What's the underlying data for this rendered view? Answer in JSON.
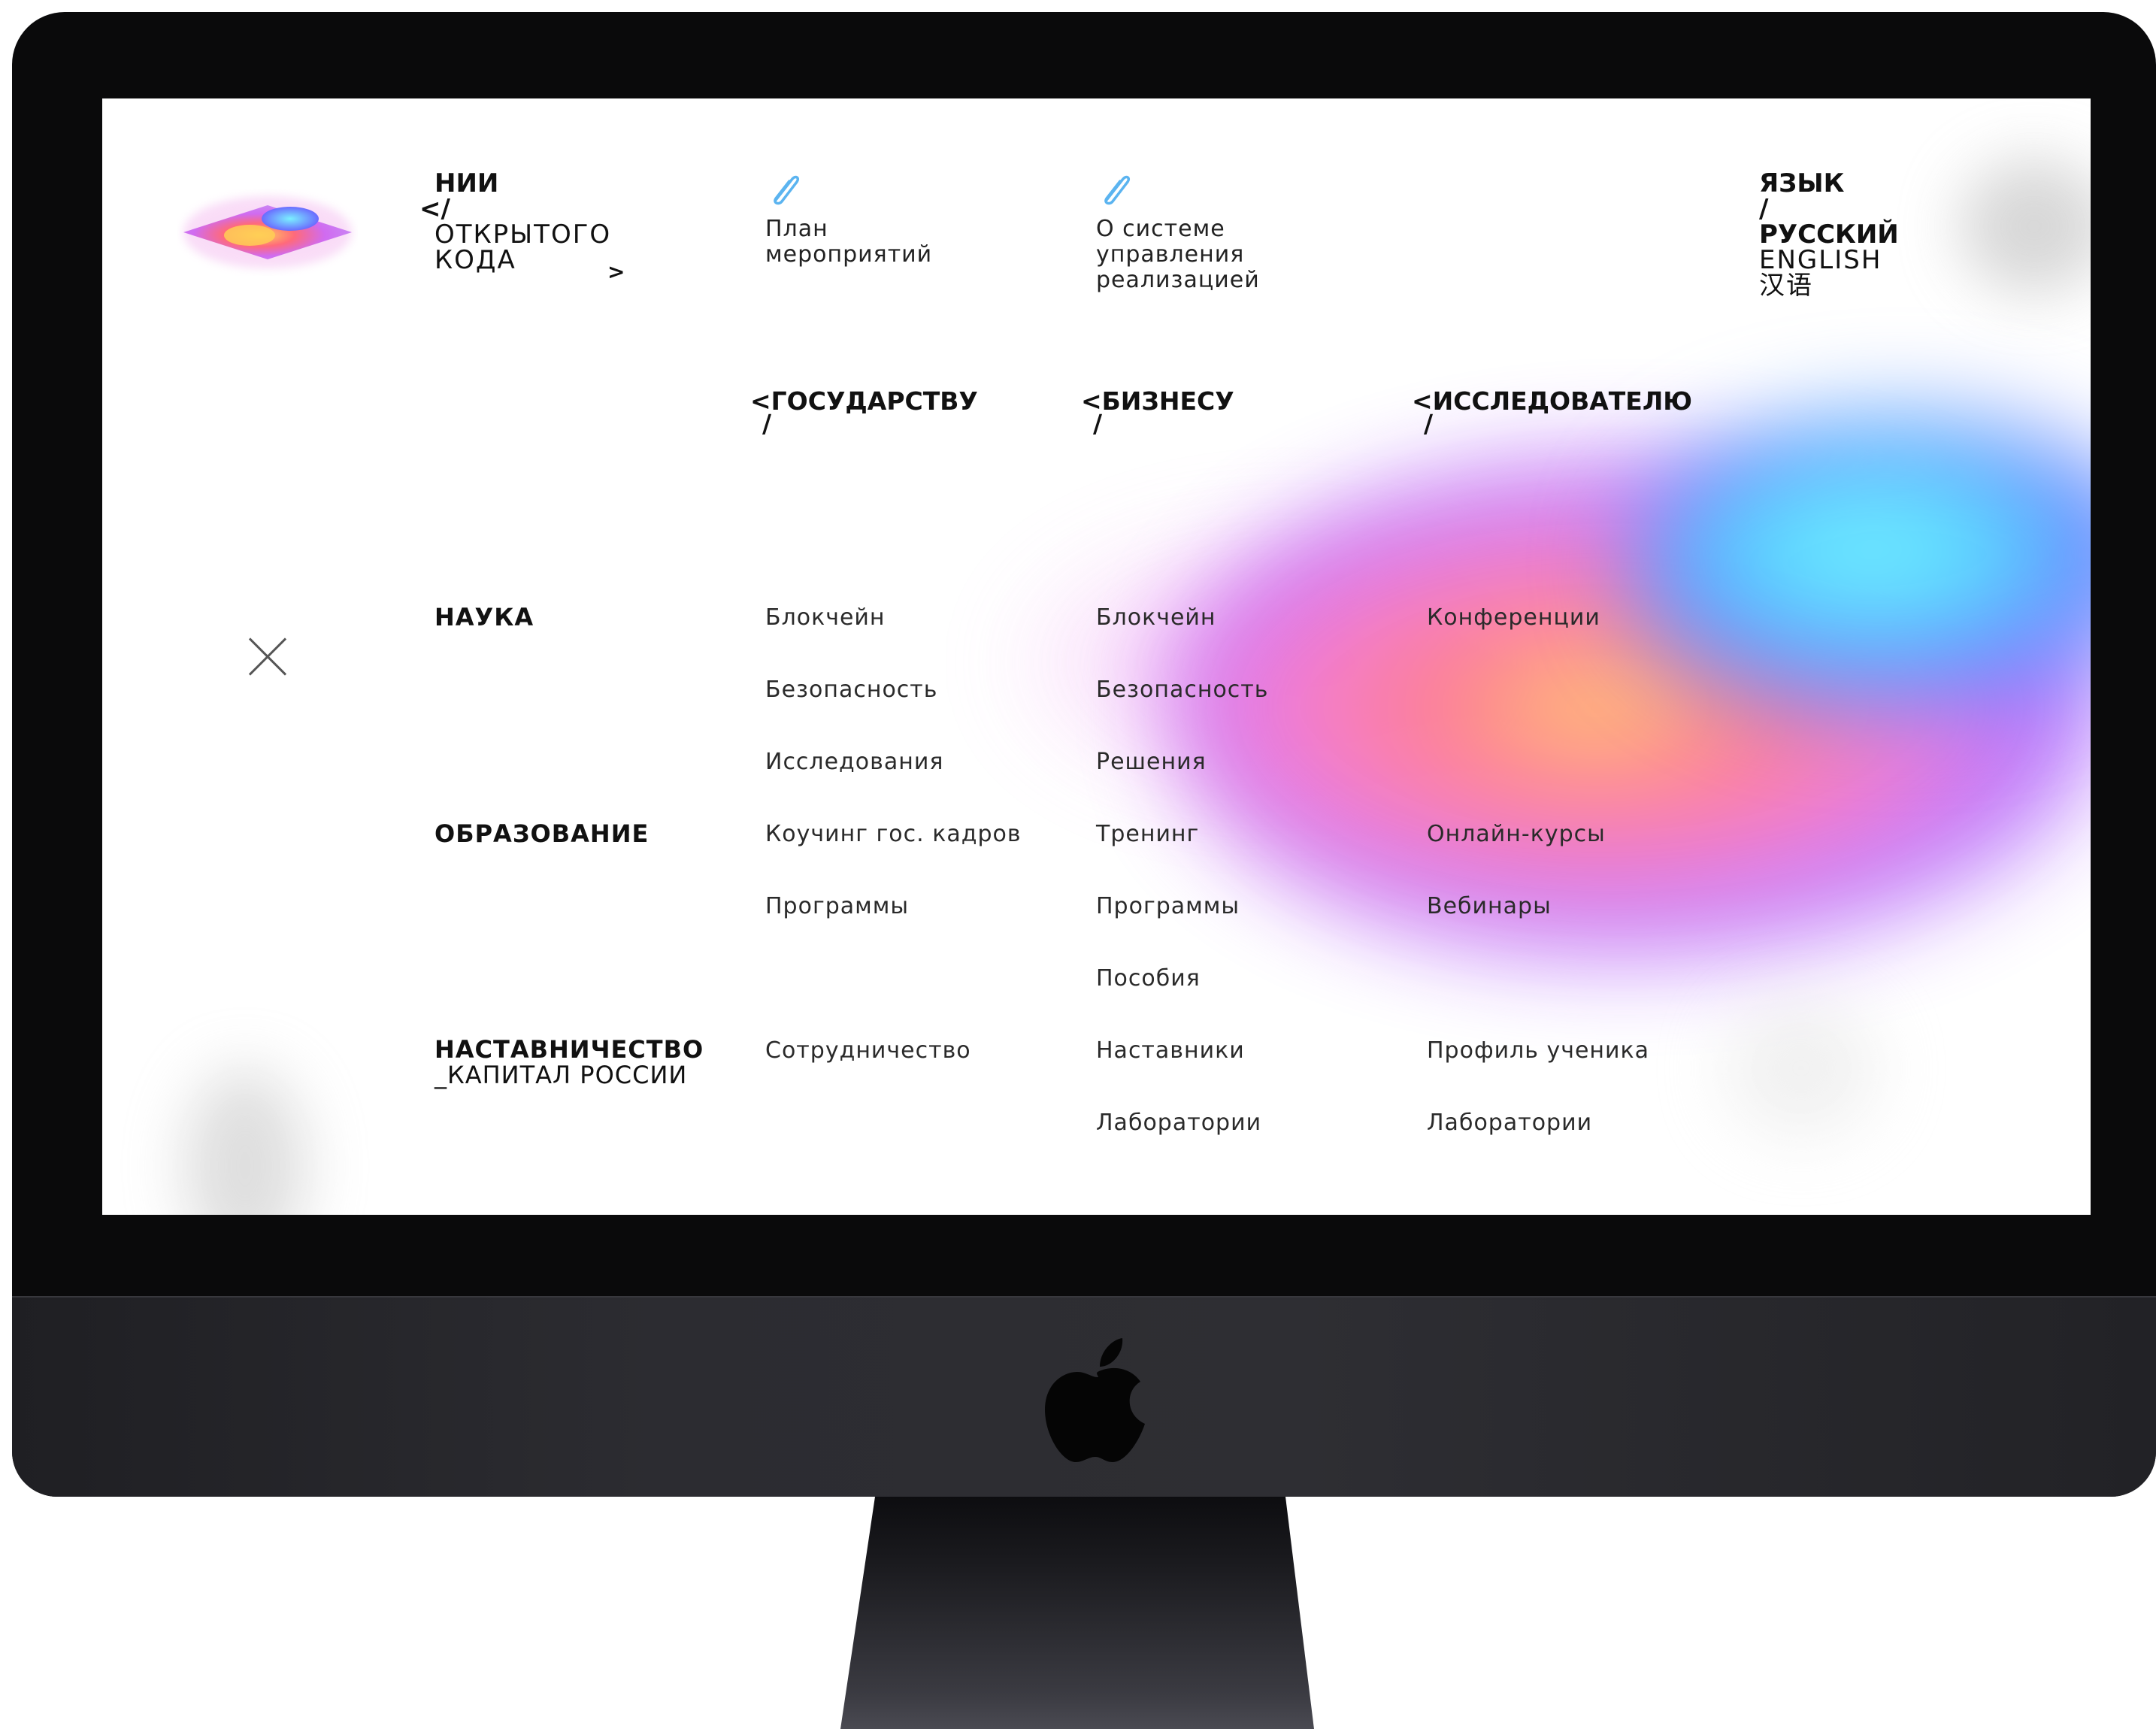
{
  "brand": {
    "line1": "НИИ",
    "line2": "</",
    "line3": "ОТКРЫТОГО",
    "line4": "КОДА",
    "line5": ">"
  },
  "nav": [
    {
      "icon": "paperclip-icon",
      "label": "План\nмероприятий"
    },
    {
      "icon": "paperclip-icon",
      "label": "О системе\nуправления\nреализацией"
    }
  ],
  "language": {
    "title": "ЯЗЫК",
    "slash": "/",
    "current": "РУССКИЙ",
    "options": [
      "ENGLISH",
      "汉语"
    ]
  },
  "audiences": [
    {
      "label": "<ГОСУДАРСТВУ",
      "slash": "/"
    },
    {
      "label": "<БИЗНЕСУ",
      "slash": "/"
    },
    {
      "label": "<ИССЛЕДОВАТЕЛЮ",
      "slash": "/"
    }
  ],
  "categories": [
    {
      "label": "НАУКА"
    },
    {
      "label": "ОБРАЗОВАНИЕ"
    },
    {
      "label": "НАСТАВНИЧЕСТВО",
      "sub": "_КАПИТАЛ РОССИИ"
    }
  ],
  "menu": {
    "gov": [
      "Блокчейн",
      "Безопасность",
      "Исследования",
      "Коучинг гос. кадров",
      "Программы",
      "Сотрудничество"
    ],
    "business": [
      "Блокчейн",
      "Безопасность",
      "Решения",
      "Тренинг",
      "Программы",
      "Пособия",
      "Наставники",
      "Лаборатории"
    ],
    "research": [
      "Конференции",
      "Онлайн-курсы",
      "Вебинары",
      "Профиль ученика",
      "Лаборатории"
    ]
  },
  "icons": {
    "close": "close-icon",
    "logo": "holographic-logo",
    "device": "apple-logo-icon"
  },
  "colors": {
    "bezel": "#0a0a0b",
    "clip": "#5bb4f0",
    "text": "#111111"
  }
}
